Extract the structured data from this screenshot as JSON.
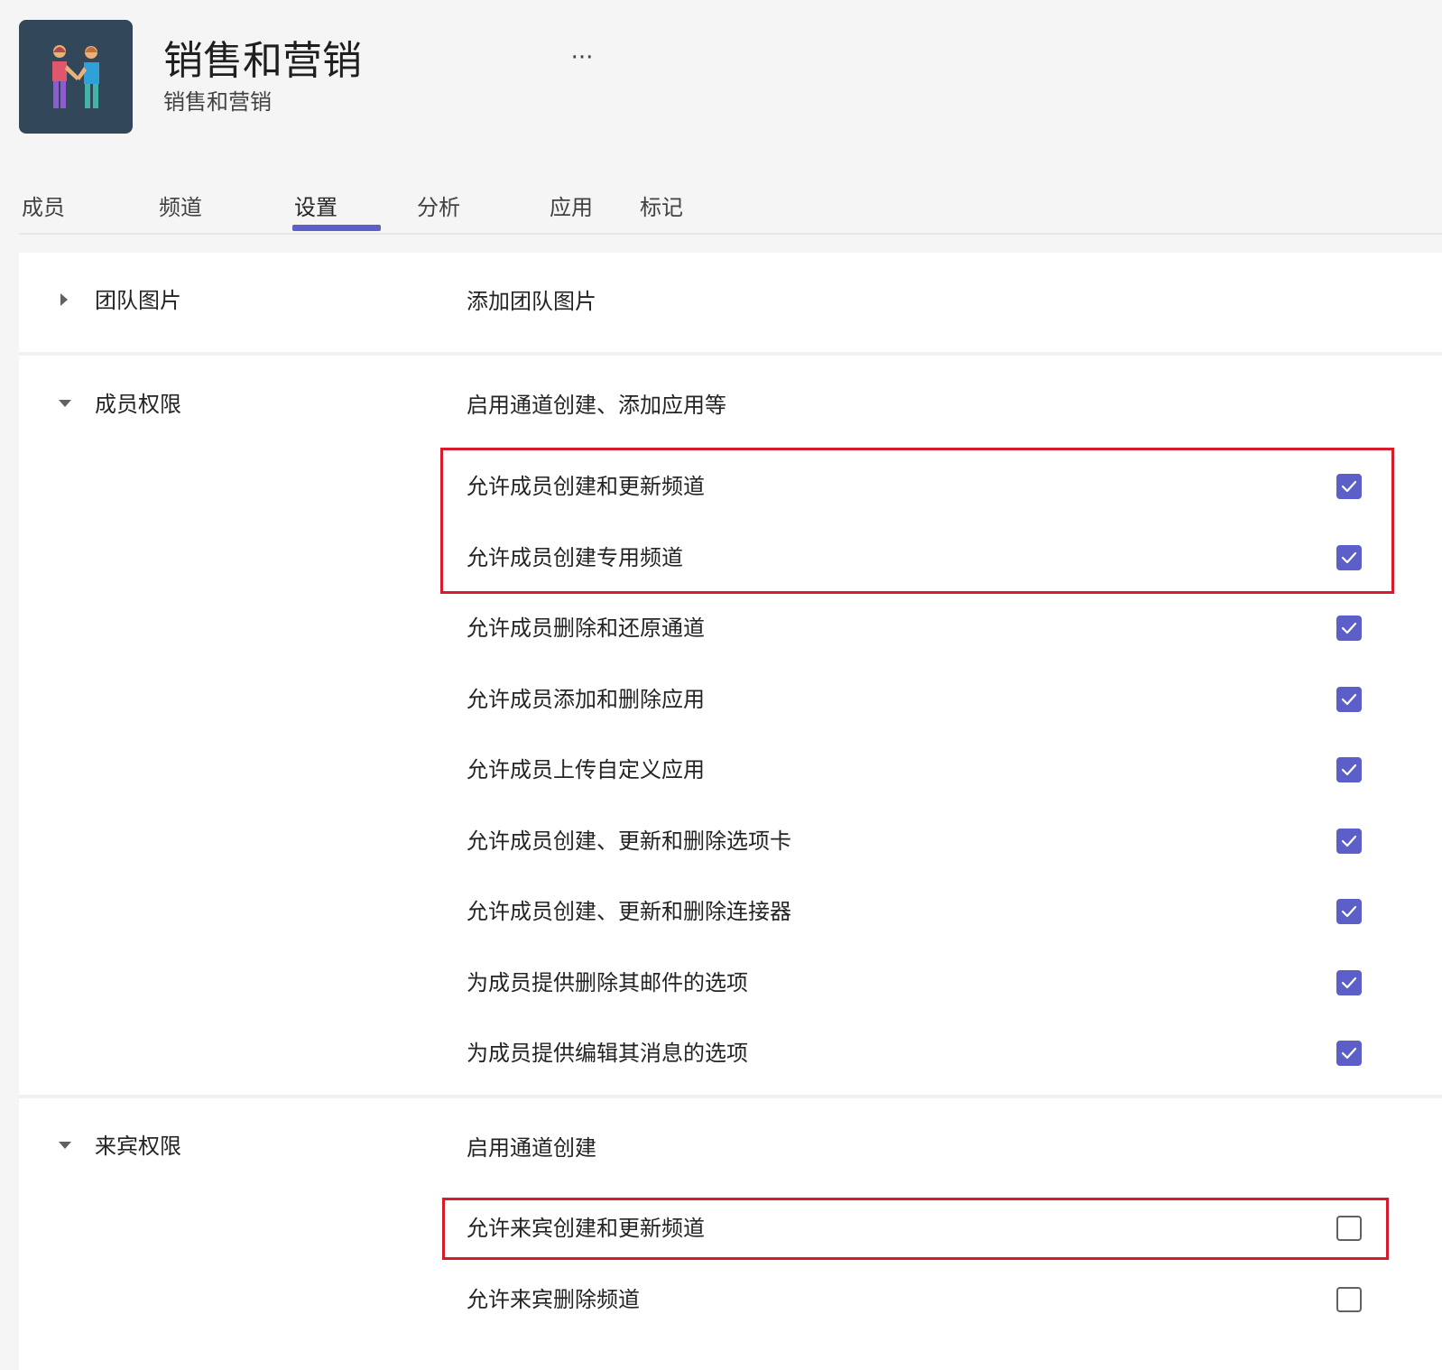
{
  "team": {
    "name": "销售和营销",
    "subtitle": "销售和营销",
    "more_label": "···",
    "avatar_icon": "people-handshake-icon"
  },
  "tabs": [
    {
      "label": "成员"
    },
    {
      "label": "频道"
    },
    {
      "label": "设置",
      "active": true
    },
    {
      "label": "分析"
    },
    {
      "label": "应用"
    },
    {
      "label": "标记"
    }
  ],
  "sections": {
    "team_picture": {
      "label": "团队图片",
      "description": "添加团队图片",
      "expanded": false
    },
    "member_permissions": {
      "label": "成员权限",
      "description": "启用通道创建、添加应用等",
      "expanded": true,
      "options": [
        {
          "label": "允许成员创建和更新频道",
          "checked": true
        },
        {
          "label": "允许成员创建专用频道",
          "checked": true
        },
        {
          "label": "允许成员删除和还原通道",
          "checked": true
        },
        {
          "label": "允许成员添加和删除应用",
          "checked": true
        },
        {
          "label": "允许成员上传自定义应用",
          "checked": true
        },
        {
          "label": "允许成员创建、更新和删除选项卡",
          "checked": true
        },
        {
          "label": "允许成员创建、更新和删除连接器",
          "checked": true
        },
        {
          "label": "为成员提供删除其邮件的选项",
          "checked": true
        },
        {
          "label": "为成员提供编辑其消息的选项",
          "checked": true
        }
      ]
    },
    "guest_permissions": {
      "label": "来宾权限",
      "description": "启用通道创建",
      "expanded": true,
      "options": [
        {
          "label": "允许来宾创建和更新频道",
          "checked": false
        },
        {
          "label": "允许来宾删除频道",
          "checked": false
        }
      ]
    }
  },
  "colors": {
    "accent": "#5b5fc7",
    "highlight": "#d81b2b",
    "avatar_bg": "#33475a"
  }
}
